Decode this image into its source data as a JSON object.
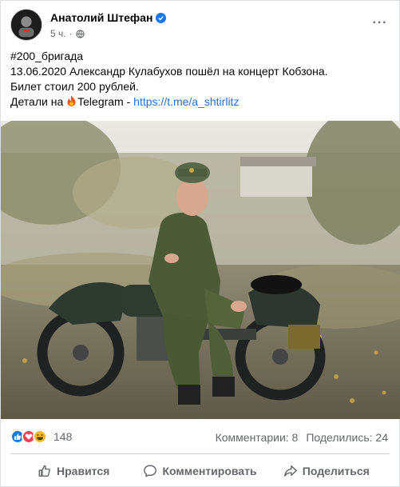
{
  "post": {
    "author": "Анатолий Штефан",
    "time": "5 ч.",
    "separator": "·",
    "more": "···",
    "text": {
      "hashtag": "#200_бригада",
      "line2": "13.06.2020  Александр Кулабухов пошёл на концерт Кобзона.",
      "line3": "Билет стоил 200 рублей.",
      "line4_prefix": "Детали на ",
      "line4_telegram": "Telegram - ",
      "link": "https://t.me/a_shtirlitz"
    },
    "reactions": {
      "count": "148",
      "comments": "Комментарии: 8",
      "shares": "Поделились: 24"
    },
    "actions": {
      "like": "Нравится",
      "comment": "Комментировать",
      "share": "Поделиться"
    }
  },
  "colors": {
    "brand_blue": "#1877f2",
    "link": "#216fdb",
    "secondary_text": "#65676b"
  },
  "icons": [
    "verified-badge-icon",
    "globe-icon",
    "fire-emoji-icon",
    "like-reaction-icon",
    "love-reaction-icon",
    "haha-reaction-icon",
    "thumbs-up-icon",
    "comment-icon",
    "share-icon"
  ]
}
